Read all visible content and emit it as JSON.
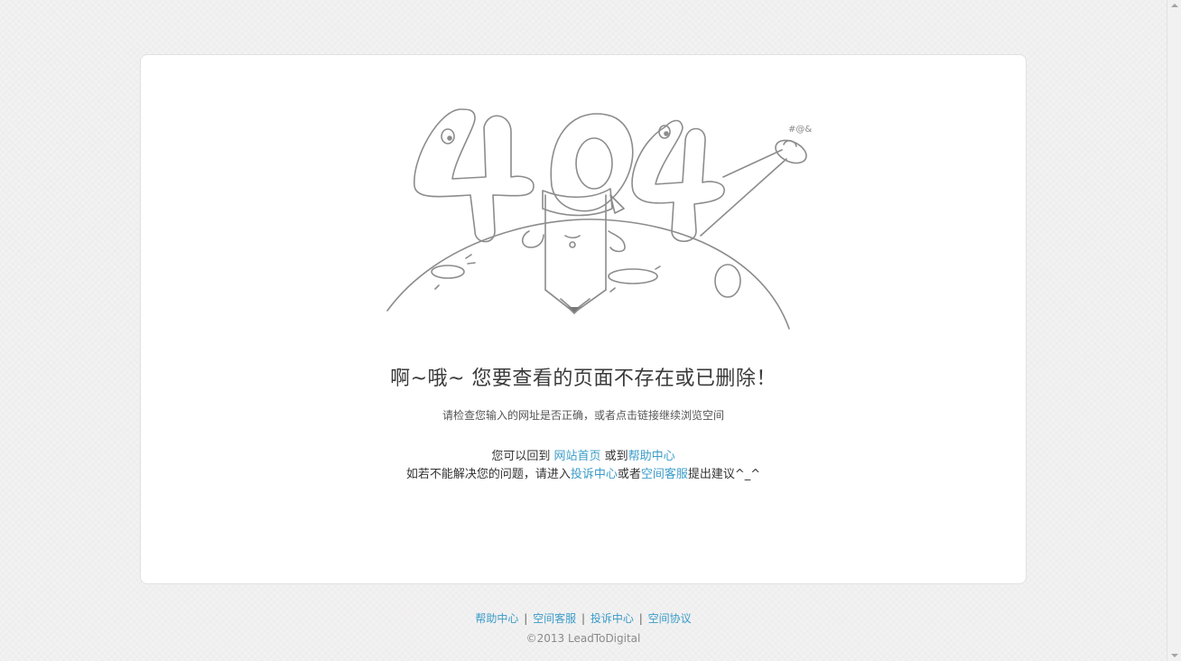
{
  "main": {
    "headline": "啊~哦~ 您要查看的页面不存在或已删除！",
    "subline": "请检查您输入的网址是否正确，或者点击链接继续浏览空间",
    "line1_prefix": "您可以回到 ",
    "link_home": "网站首页",
    "line1_mid": " 或到",
    "link_help": "帮助中心",
    "line2_prefix": "如若不能解决您的问题，请进入",
    "link_complaint": "投诉中心",
    "line2_mid": "或者",
    "link_service": "空间客服",
    "line2_suffix": "提出建议^_^"
  },
  "footer": {
    "links": [
      "帮助中心",
      "空间客服",
      "投诉中心",
      "空间协议"
    ],
    "separator": "|",
    "copyright": "©2013 LeadToDigital"
  },
  "illustration": {
    "icon": "404-pencil-planet-illustration",
    "ufo_symbols": "#@&"
  },
  "colors": {
    "link": "#3a9cc9",
    "background": "#f3f2f2",
    "card": "#ffffff"
  }
}
